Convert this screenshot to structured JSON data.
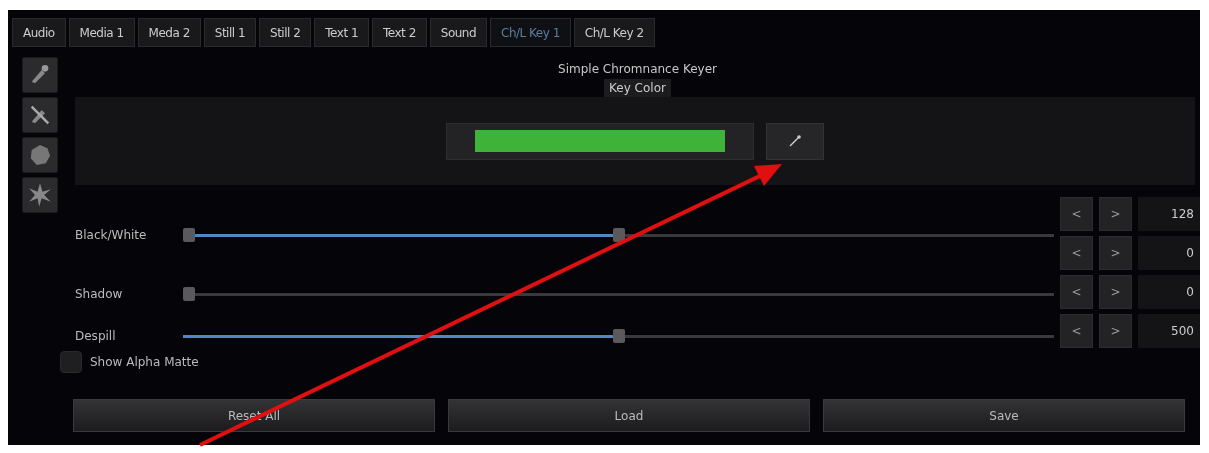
{
  "tabs": [
    {
      "label": "Audio",
      "selected": false
    },
    {
      "label": "Media 1",
      "selected": false
    },
    {
      "label": "Meda 2",
      "selected": false
    },
    {
      "label": "Still 1",
      "selected": false
    },
    {
      "label": "Still 2",
      "selected": false
    },
    {
      "label": "Text 1",
      "selected": false
    },
    {
      "label": "Text 2",
      "selected": false
    },
    {
      "label": "Sound",
      "selected": false
    },
    {
      "label": "Ch/L Key 1",
      "selected": true
    },
    {
      "label": "Ch/L Key 2",
      "selected": false
    }
  ],
  "tool_icons": [
    {
      "kind": "brush"
    },
    {
      "kind": "brush-off"
    },
    {
      "kind": "blob"
    },
    {
      "kind": "burst"
    }
  ],
  "keyer": {
    "title": "Simple Chromnance Keyer",
    "key_color_label": "Key Color",
    "color": "#3fb23a"
  },
  "sliders": [
    {
      "label": "Black/White",
      "thumbs": [
        {
          "level": 0
        },
        {
          "level": 0.5
        }
      ]
    },
    {
      "label": "Shadow",
      "thumbs": [
        {
          "level": 0
        }
      ]
    },
    {
      "label": "Despill",
      "thumbs": [
        {
          "level": 0.5
        }
      ]
    }
  ],
  "value_rows": [
    {
      "decrement": "<",
      "increment": ">",
      "value": "128"
    },
    {
      "decrement": "<",
      "increment": ">",
      "value": "0"
    },
    {
      "decrement": "<",
      "increment": ">",
      "value": "0"
    },
    {
      "decrement": "<",
      "increment": ">",
      "value": "500"
    }
  ],
  "show_alpha_matte": {
    "label": "Show Alpha Matte",
    "checked": false
  },
  "buttons": [
    "Reset All",
    "Load",
    "Save"
  ]
}
